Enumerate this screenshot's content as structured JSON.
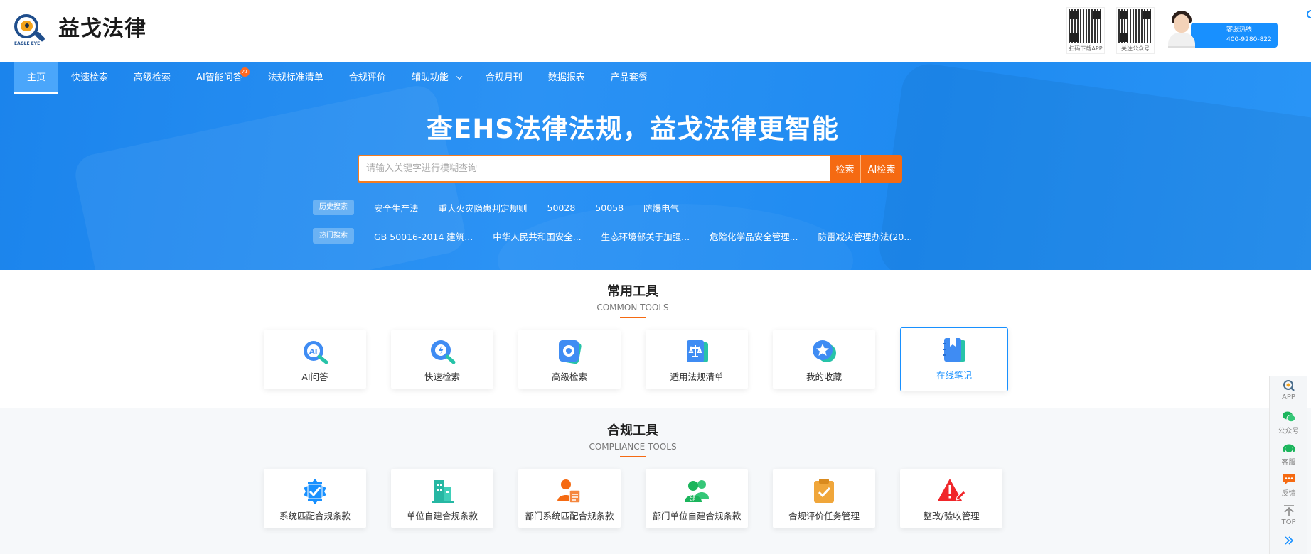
{
  "brand": {
    "name": "益戈法律",
    "logo_text": "EAGLE EYE"
  },
  "header": {
    "qr_codes": [
      {
        "caption": "扫码下载APP"
      },
      {
        "caption": "关注公众号"
      }
    ],
    "hotline": {
      "label": "客服热线",
      "number": "400-9280-822"
    }
  },
  "nav": {
    "items": [
      {
        "label": "主页",
        "active": true
      },
      {
        "label": "快速检索"
      },
      {
        "label": "高级检索"
      },
      {
        "label": "AI智能问答",
        "badge": "AI"
      },
      {
        "label": "法规标准清单"
      },
      {
        "label": "合规评价"
      },
      {
        "label": "辅助功能",
        "dropdown": true
      },
      {
        "label": "合规月刊"
      },
      {
        "label": "数据报表"
      },
      {
        "label": "产品套餐"
      }
    ]
  },
  "hero": {
    "title": "查EHS法律法规，益戈法律更智能",
    "search": {
      "placeholder": "请输入关键字进行模糊查询",
      "value": "",
      "search_label": "检索",
      "ai_search_label": "AI检索"
    },
    "history": {
      "label": "历史搜索",
      "tags": [
        "安全生产法",
        "重大火灾隐患判定规则",
        "50028",
        "50058",
        "防爆电气"
      ]
    },
    "hot": {
      "label": "热门搜索",
      "tags": [
        "GB 50016-2014 建筑...",
        "中华人民共和国安全...",
        "生态环境部关于加强...",
        "危险化学品安全管理...",
        "防雷减灾管理办法(20..."
      ]
    }
  },
  "common_tools": {
    "title": "常用工具",
    "subtitle": "COMMON TOOLS",
    "items": [
      {
        "label": "AI问答",
        "icon": "ai-qa-icon",
        "color": "#3f8cf3"
      },
      {
        "label": "快速检索",
        "icon": "quick-search-icon",
        "color": "#3f8cf3"
      },
      {
        "label": "高级检索",
        "icon": "advanced-search-icon",
        "color": "#3f8cf3"
      },
      {
        "label": "适用法规清单",
        "icon": "regulation-list-icon",
        "color": "#3f8cf3"
      },
      {
        "label": "我的收藏",
        "icon": "favorites-icon",
        "color": "#3f8cf3"
      },
      {
        "label": "在线笔记",
        "icon": "notes-icon",
        "color": "#3f8cf3",
        "selected": true
      }
    ]
  },
  "compliance_tools": {
    "title": "合规工具",
    "subtitle": "COMPLIANCE TOOLS",
    "items": [
      {
        "label": "系统匹配合规条款",
        "icon": "system-match-icon",
        "color": "#1890ff"
      },
      {
        "label": "单位自建合规条款",
        "icon": "building-icon",
        "color": "#26b7a3"
      },
      {
        "label": "部门系统匹配合规条款",
        "icon": "department-user-icon",
        "color": "#f56a12"
      },
      {
        "label": "部门单位自建合规条款",
        "icon": "department-group-icon",
        "color": "#1bb55c"
      },
      {
        "label": "合规评价任务管理",
        "icon": "task-clipboard-icon",
        "color": "#f0a63a"
      },
      {
        "label": "整改/验收管理",
        "icon": "warning-edit-icon",
        "color": "#f0262a"
      }
    ]
  },
  "sidebar": {
    "items": [
      {
        "label": "APP",
        "icon": "app-search-icon"
      },
      {
        "label": "公众号",
        "icon": "wechat-icon"
      },
      {
        "label": "客服",
        "icon": "customer-service-icon"
      },
      {
        "label": "反馈",
        "icon": "feedback-icon"
      },
      {
        "label": "TOP",
        "icon": "back-to-top-icon"
      }
    ],
    "collapse_icon": "double-chevron-right-icon"
  }
}
